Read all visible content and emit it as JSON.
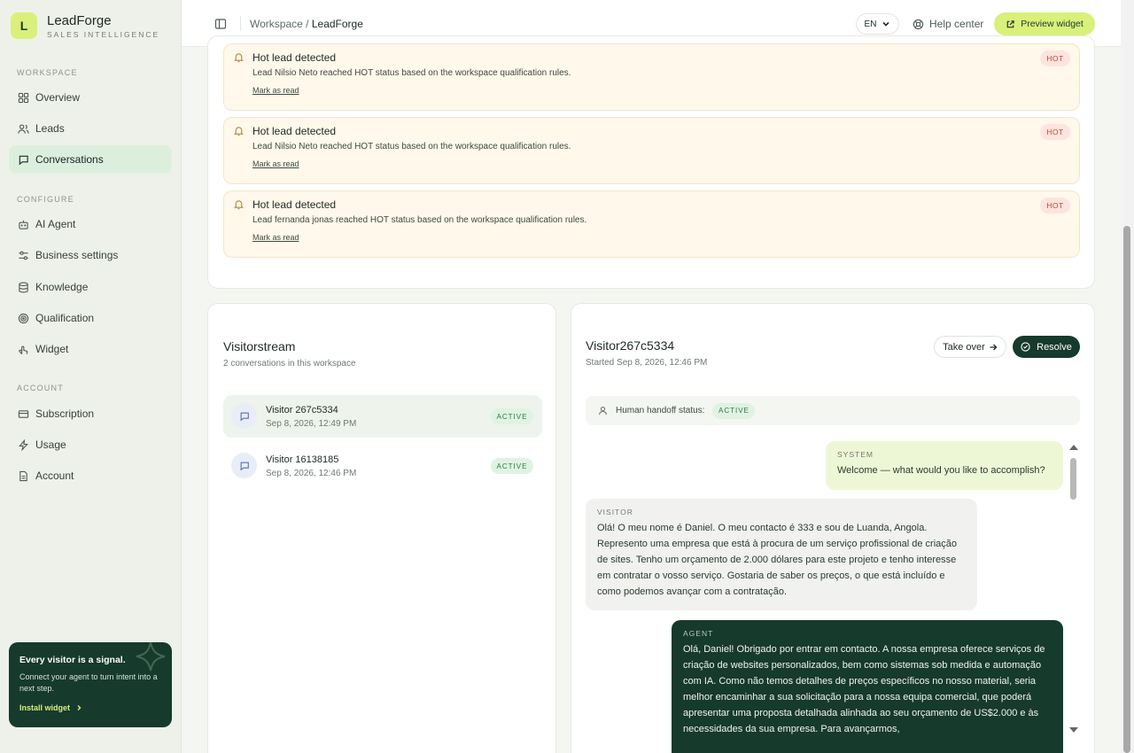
{
  "brand": {
    "logo_letter": "L",
    "name": "LeadForge",
    "tagline": "SALES INTELLIGENCE"
  },
  "sidebar": {
    "sections": [
      {
        "label": "WORKSPACE",
        "items": [
          "Overview",
          "Leads",
          "Conversations"
        ]
      },
      {
        "label": "CONFIGURE",
        "items": [
          "AI Agent",
          "Business settings",
          "Knowledge",
          "Qualification",
          "Widget"
        ]
      },
      {
        "label": "ACCOUNT",
        "items": [
          "Subscription",
          "Usage",
          "Account"
        ]
      }
    ],
    "active_item": "Conversations",
    "promo": {
      "title": "Every visitor is a signal.",
      "text": "Connect your agent to turn intent into a next step.",
      "link": "Install widget"
    }
  },
  "topbar": {
    "breadcrumb_parent": "Workspace",
    "breadcrumb_sep": "/",
    "breadcrumb_current": "LeadForge",
    "language": "EN",
    "help": "Help center",
    "preview": "Preview widget"
  },
  "alerts": [
    {
      "title": "Hot lead detected",
      "body": "Lead Nilsio Neto reached HOT status based on the workspace qualification rules.",
      "link": "Mark as read",
      "badge": "HOT"
    },
    {
      "title": "Hot lead detected",
      "body": "Lead Nilsio Neto reached HOT status based on the workspace qualification rules.",
      "link": "Mark as read",
      "badge": "HOT"
    },
    {
      "title": "Hot lead detected",
      "body": "Lead fernanda jonas reached HOT status based on the workspace qualification rules.",
      "link": "Mark as read",
      "badge": "HOT"
    }
  ],
  "stream": {
    "title": "Visitorstream",
    "subtitle": "2 conversations in this workspace",
    "conversations": [
      {
        "name": "Visitor 267c5334",
        "time": "Sep 8, 2026, 12:49 PM",
        "status": "ACTIVE"
      },
      {
        "name": "Visitor 16138185",
        "time": "Sep 8, 2026, 12:46 PM",
        "status": "ACTIVE"
      }
    ]
  },
  "conversation": {
    "title": "Visitor267c5334",
    "started": "Started Sep 8, 2026, 12:46 PM",
    "takeover": "Take over",
    "resolve": "Resolve",
    "handoff_label": "Human handoff status:",
    "handoff_status": "ACTIVE",
    "messages": [
      {
        "role": "SYSTEM",
        "text": "Welcome — what would you like to accomplish?"
      },
      {
        "role": "VISITOR",
        "text": "Olá! O meu nome é Daniel. O meu contacto é 333 e sou de Luanda, Angola. Represento uma empresa que está à procura de um serviço profissional de criação de sites. Tenho um orçamento de 2.000 dólares para este projeto e tenho interesse em contratar o vosso serviço. Gostaria de saber os preços, o que está incluído e como podemos avançar com a contratação."
      },
      {
        "role": "AGENT",
        "text": "Olá, Daniel! Obrigado por entrar em contacto. A nossa empresa oferece serviços de criação de websites personalizados, bem como sistemas sob medida e automação com IA. Como não temos detalhes de preços específicos no nosso material, seria melhor encaminhar a sua solicitação para a nossa equipa comercial, que poderá apresentar uma proposta detalhada alinhada ao seu orçamento de US$2.000 e às necessidades da sua empresa. Para avançarmos,"
      }
    ]
  },
  "colors": {
    "accent": "#d9f07a",
    "dark": "#163a2c",
    "hot": "#c0473a",
    "active": "#2e7a45"
  }
}
